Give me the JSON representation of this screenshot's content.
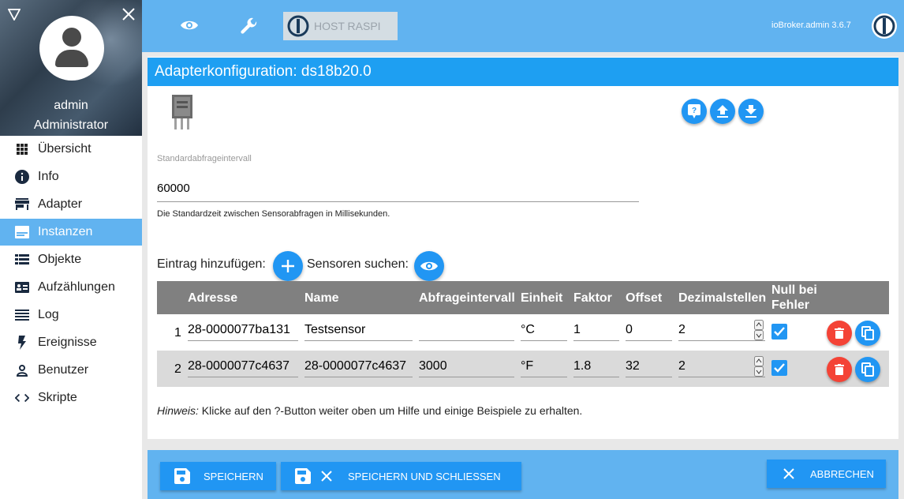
{
  "sidebar": {
    "user_name": "admin",
    "user_role": "Administrator",
    "items": [
      {
        "label": "Übersicht",
        "icon": "grid-icon"
      },
      {
        "label": "Info",
        "icon": "info-icon"
      },
      {
        "label": "Adapter",
        "icon": "store-icon"
      },
      {
        "label": "Instanzen",
        "icon": "instances-icon",
        "active": true
      },
      {
        "label": "Objekte",
        "icon": "list-icon"
      },
      {
        "label": "Aufzählungen",
        "icon": "enum-icon"
      },
      {
        "label": "Log",
        "icon": "log-icon"
      },
      {
        "label": "Ereignisse",
        "icon": "bolt-icon"
      },
      {
        "label": "Benutzer",
        "icon": "person-icon"
      },
      {
        "label": "Skripte",
        "icon": "code-icon"
      }
    ]
  },
  "topbar": {
    "host_label": "HOST RASPI",
    "version": "ioBroker.admin 3.6.7"
  },
  "config": {
    "title": "Adapterkonfiguration: ds18b20.0",
    "interval_label": "Standardabfrageintervall",
    "interval_value": "60000",
    "interval_help": "Die Standardzeit zwischen Sensorabfragen in Millisekunden.",
    "add_entry_label": "Eintrag hinzufügen:",
    "search_sensors_label": "Sensoren suchen:"
  },
  "table": {
    "headers": {
      "address": "Adresse",
      "name": "Name",
      "interval": "Abfrageintervall",
      "unit": "Einheit",
      "factor": "Faktor",
      "offset": "Offset",
      "decimals": "Dezimalstellen",
      "null_on_error": "Null bei Fehler",
      "null_on_error_line1": "Null bei",
      "null_on_error_line2": "Fehler"
    },
    "rows": [
      {
        "num": "1",
        "address": "28-0000077ba131",
        "name": "Testsensor",
        "interval": "",
        "unit": "°C",
        "factor": "1",
        "offset": "0",
        "decimals": "2",
        "null_on_error": true
      },
      {
        "num": "2",
        "address": "28-0000077c4637",
        "name": "28-0000077c4637",
        "interval": "3000",
        "unit": "°F",
        "factor": "1.8",
        "offset": "32",
        "decimals": "2",
        "null_on_error": true
      }
    ]
  },
  "hint": {
    "prefix": "Hinweis:",
    "text": " Klicke auf den ?-Button weiter oben um Hilfe und einige Beispiele zu erhalten."
  },
  "footer": {
    "save": "SPEICHERN",
    "save_close": "SPEICHERN UND SCHLIESSEN",
    "cancel": "ABBRECHEN"
  },
  "colors": {
    "accent": "#2196f3",
    "header_bar": "#61b3f0",
    "title_bar": "#1e9ff2",
    "delete": "#f44336"
  }
}
